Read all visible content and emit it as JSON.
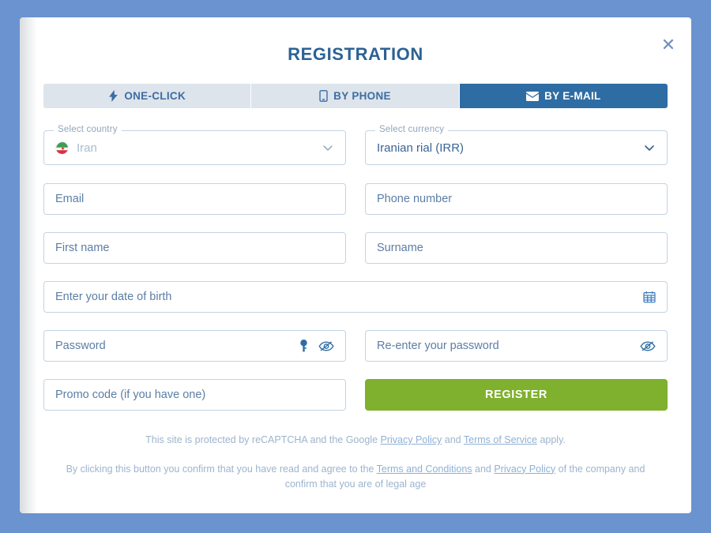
{
  "page": {
    "background_color": "#6a93cf"
  },
  "modal": {
    "title": "REGISTRATION",
    "close_label": "✕",
    "accent_color": "#2e6da4",
    "register_color": "#7fb02e"
  },
  "tabs": [
    {
      "label": "ONE-CLICK",
      "icon": "lightning-bolt-icon",
      "active": false
    },
    {
      "label": "BY PHONE",
      "icon": "mobile-phone-icon",
      "active": false
    },
    {
      "label": "BY E-MAIL",
      "icon": "envelope-icon",
      "active": true
    }
  ],
  "form": {
    "country": {
      "label": "Select country",
      "value": "Iran",
      "flag": "iran-flag-icon"
    },
    "currency": {
      "label": "Select currency",
      "value": "Iranian rial (IRR)"
    },
    "email": {
      "placeholder": "Email",
      "value": ""
    },
    "phone": {
      "placeholder": "Phone number",
      "value": ""
    },
    "first_name": {
      "placeholder": "First name",
      "value": ""
    },
    "surname": {
      "placeholder": "Surname",
      "value": ""
    },
    "birth_date": {
      "placeholder": "Enter your date of birth",
      "value": ""
    },
    "password": {
      "placeholder": "Password",
      "value": ""
    },
    "password_repeat": {
      "placeholder": "Re-enter your password",
      "value": ""
    },
    "promo_code": {
      "placeholder": "Promo code (if you have one)",
      "value": ""
    },
    "register_label": "REGISTER"
  },
  "legal": {
    "recaptcha": {
      "part1": "This site is protected by reCAPTCHA and the Google ",
      "link1": "Privacy Policy",
      "part2": " and ",
      "link2": "Terms of Service",
      "part3": " apply."
    },
    "terms": {
      "part1": "By clicking this button you confirm that you have read and agree to the ",
      "link1": "Terms and Conditions",
      "part2": " and ",
      "link2": "Privacy Policy",
      "part3": " of the company and confirm that you are of legal age"
    }
  }
}
